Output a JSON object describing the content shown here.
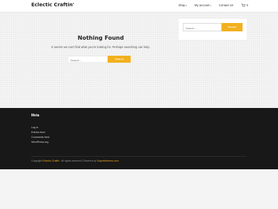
{
  "colors": {
    "accent": "#f2b01e",
    "footer_bg": "#181818",
    "page_bg": "#f3f3f3"
  },
  "header": {
    "logo": "Eclectic Craftin'",
    "nav": [
      {
        "label": "Shop",
        "has_dropdown": true
      },
      {
        "label": "My account",
        "has_dropdown": true
      },
      {
        "label": "Contact Us",
        "has_dropdown": false
      }
    ],
    "cart": {
      "icon": "cart-icon",
      "count": "0"
    }
  },
  "main": {
    "title": "Nothing Found",
    "message": "It seems we can't find what you're looking for. Perhaps searching can help.",
    "search": {
      "placeholder": "Search ...",
      "button": "Search"
    }
  },
  "sidebar": {
    "search": {
      "placeholder": "Search ...",
      "button": "Search"
    }
  },
  "footer": {
    "meta_title": "Meta",
    "meta_links": [
      "Log in",
      "Entries feed",
      "Comments feed",
      "WordPress.org"
    ],
    "copyright": {
      "prefix": "Copyright",
      "site": "Eclectic Craftin'",
      "middle": ". All rights reserved | Powered by",
      "powered": "Superbthemes.com"
    }
  }
}
